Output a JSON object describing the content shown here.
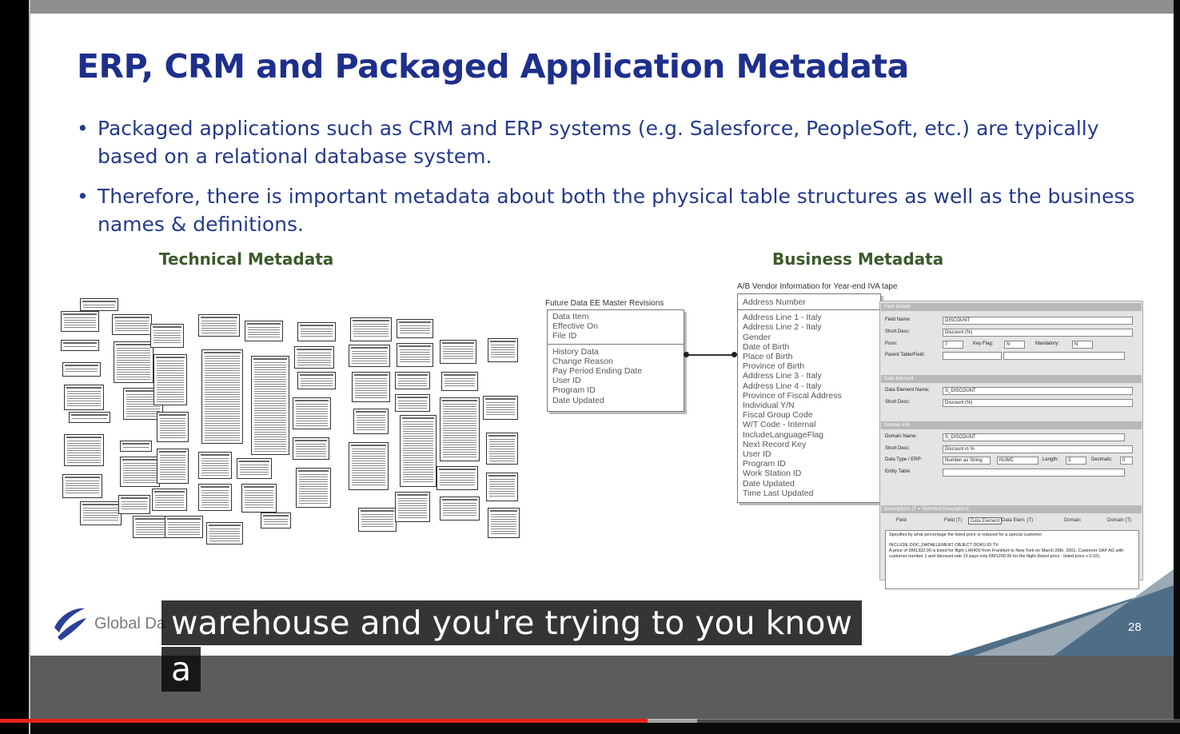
{
  "slide": {
    "title": "ERP, CRM and Packaged Application Metadata",
    "bullets": [
      "Packaged applications such as CRM and ERP systems (e.g. Salesforce, PeopleSoft, etc.) are typically based on a relational database system.",
      "Therefore, there is important metadata about both the physical table structures as well as the business names & definitions."
    ],
    "technical_heading": "Technical Metadata",
    "business_heading": "Business Metadata",
    "logo_text": "Global Da",
    "page_number": "28"
  },
  "er_diagram": {
    "left_table_caption": "Future Data EE Master Revisions",
    "left_table_keys": [
      "Data Item",
      "Effective On",
      "File ID"
    ],
    "left_table_fields": [
      "History Data",
      "Change Reason",
      "Pay Period Ending Date",
      "User ID",
      "Program ID",
      "Date Updated"
    ],
    "right_table_caption": "A/B Vendor Information for Year-end IVA tape",
    "right_table_keys": [
      "Address Number"
    ],
    "right_table_fields": [
      "Address Line 1 - Italy",
      "Address Line 2 - Italy",
      "Gender",
      "Date of Birth",
      "Place of Birth",
      "Province of Birth",
      "Address Line 3 - Italy",
      "Address Line 4 - Italy",
      "Province of Fiscal Address",
      "Individual Y/N",
      "Fiscal Group Code",
      "W/T Code - Internal",
      "IncludeLanguageFlag",
      "Next Record Key",
      "User ID",
      "Program ID",
      "Work Station ID",
      "Date Updated",
      "Time Last Updated"
    ]
  },
  "business_form": {
    "sections": [
      "Field Details",
      "Data Element",
      "Domain Info",
      "Descriptions   (T = Technical Description)"
    ],
    "field_name_label": "Field Name:",
    "field_name": "DISCOUNT",
    "short_desc_label": "Short Desc:",
    "short_desc": "Discount (%)",
    "posn_label": "Posn:",
    "posn": "7",
    "key_flag_label": "Key Flag:",
    "key_flag": "N",
    "mandatory_label": "Mandatory:",
    "mandatory": "N",
    "parent_table_label": "Parent Table/Field:",
    "data_element_label": "Data Element Name:",
    "data_element": "S_DISCOUNT",
    "de_short_desc": "Discount (%)",
    "domain_name_label": "Domain Name:",
    "domain_name": "S_DISCOUNT",
    "domain_short_desc": "Discount in %",
    "data_type_label": "Data Type / ERP:",
    "data_type": "Number as String",
    "data_type_erp": "NUMC",
    "length_label": "Length:",
    "length": "3",
    "decimals_label": "Decimals:",
    "decimals": "0",
    "entity_table_label": "Entity Table:",
    "tabs": [
      "Field",
      "Field (T)",
      "Data Element",
      "Data Elem. (T)",
      "Domain",
      "Domain (T)"
    ],
    "description_lines": [
      "Specifies by what percentage the listed price is reduced for a special customer.",
      "INCLUDE DOC_DATAELEMENT OBJECT DOKU ID TX",
      "A price of DM1332.00 is listed for flight LH0400 from Frankfurt to New York on March 26th, 2001. Customer SAP AG with customer number 1 and discount rate 10 pays only DM1200.00 for the flight (listed price - listed price x 0.10)."
    ]
  },
  "caption": {
    "line1": "warehouse and you're trying to you know",
    "line2": "a"
  },
  "player": {
    "played_fraction": 0.549,
    "buffered_fraction": 0.591,
    "progress_color": "#e8211b"
  },
  "colors": {
    "title": "#1e2f8c",
    "bullet_text": "#243a8c",
    "heading_green": "#3a5a2a"
  }
}
